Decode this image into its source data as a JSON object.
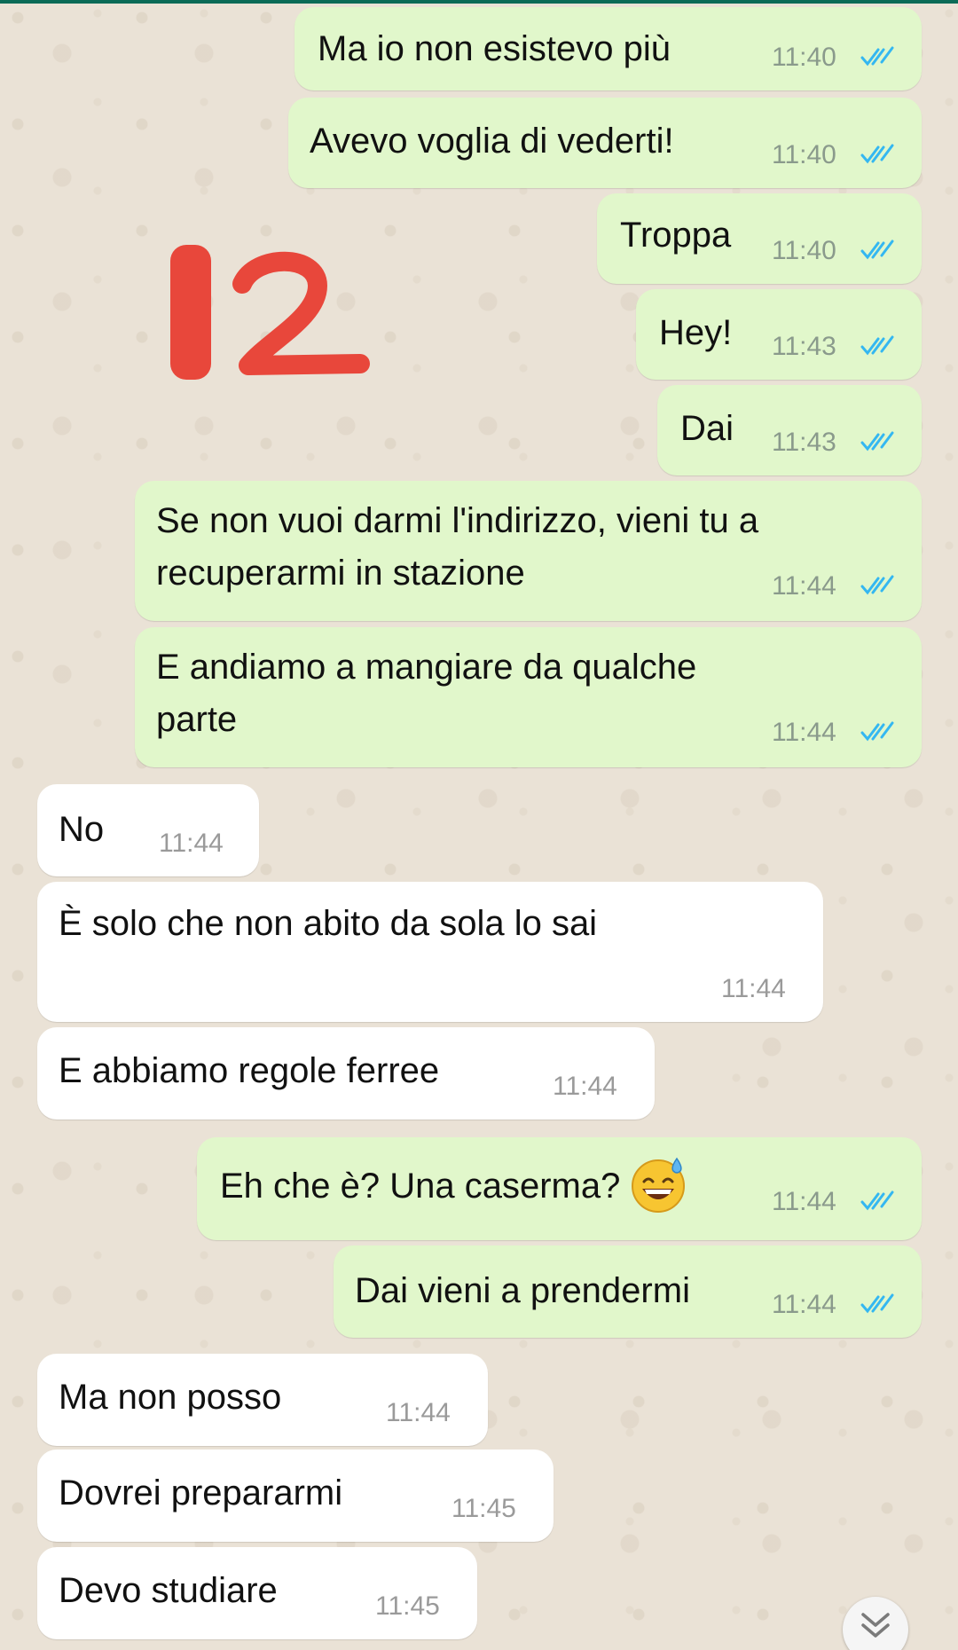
{
  "annotation": {
    "number": "12"
  },
  "messages": [
    {
      "text": "Ma io non esistevo più",
      "time": "11:40"
    },
    {
      "text": "Avevo voglia di vederti!",
      "time": "11:40"
    },
    {
      "text": "Troppa",
      "time": "11:40"
    },
    {
      "text": "Hey!",
      "time": "11:43"
    },
    {
      "text": "Dai",
      "time": "11:43"
    },
    {
      "line1": "Se non vuoi darmi l'indirizzo, vieni tu a",
      "line2": "recuperarmi in stazione",
      "time": "11:44"
    },
    {
      "line1": "E andiamo a mangiare da qualche",
      "line2": "parte",
      "time": "11:44"
    },
    {
      "text": "No",
      "time": "11:44"
    },
    {
      "text": "È solo che non abito da sola lo sai",
      "time": "11:44"
    },
    {
      "text": "E abbiamo regole ferree",
      "time": "11:44"
    },
    {
      "text": "Eh che è? Una caserma?",
      "emoji": "sweat-smile-emoji",
      "time": "11:44"
    },
    {
      "text": "Dai vieni a prendermi",
      "time": "11:44"
    },
    {
      "text": "Ma non posso",
      "time": "11:44"
    },
    {
      "text": "Dovrei prepararmi",
      "time": "11:45"
    },
    {
      "text": "Devo studiare",
      "time": "11:45"
    }
  ],
  "icons": {
    "read_receipt": "double-check-icon",
    "scroll_down": "double-chevron-down-icon"
  },
  "colors": {
    "outgoing_bubble": "#E1F7CB",
    "incoming_bubble": "#FFFFFF",
    "read_ticks": "#34B7F1",
    "annotation_red": "#E8473B",
    "background": "#EAE2D6"
  }
}
